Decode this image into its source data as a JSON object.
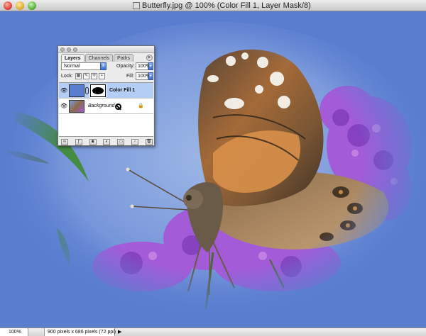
{
  "window": {
    "title": "Butterfly.jpg @ 100% (Color Fill 1, Layer Mask/8)"
  },
  "layers_palette": {
    "tabs": [
      {
        "label": "Layers",
        "active": true
      },
      {
        "label": "Channels",
        "active": false
      },
      {
        "label": "Paths",
        "active": false
      }
    ],
    "blend_mode": "Normal",
    "opacity_label": "Opacity:",
    "opacity_value": "100%",
    "lock_label": "Lock:",
    "fill_label": "Fill:",
    "fill_value": "100%",
    "layers": [
      {
        "name": "Color Fill 1",
        "selected": true,
        "visible": true,
        "has_mask": true
      },
      {
        "name": "Background",
        "selected": false,
        "visible": true,
        "locked": true
      }
    ]
  },
  "status_bar": {
    "zoom": "100%",
    "doc_info": "900 pixels x 686 pixels (72 ppi)"
  },
  "colors": {
    "fill_color": "#5a7dd0",
    "selected_layer": "#b3cdf5"
  }
}
